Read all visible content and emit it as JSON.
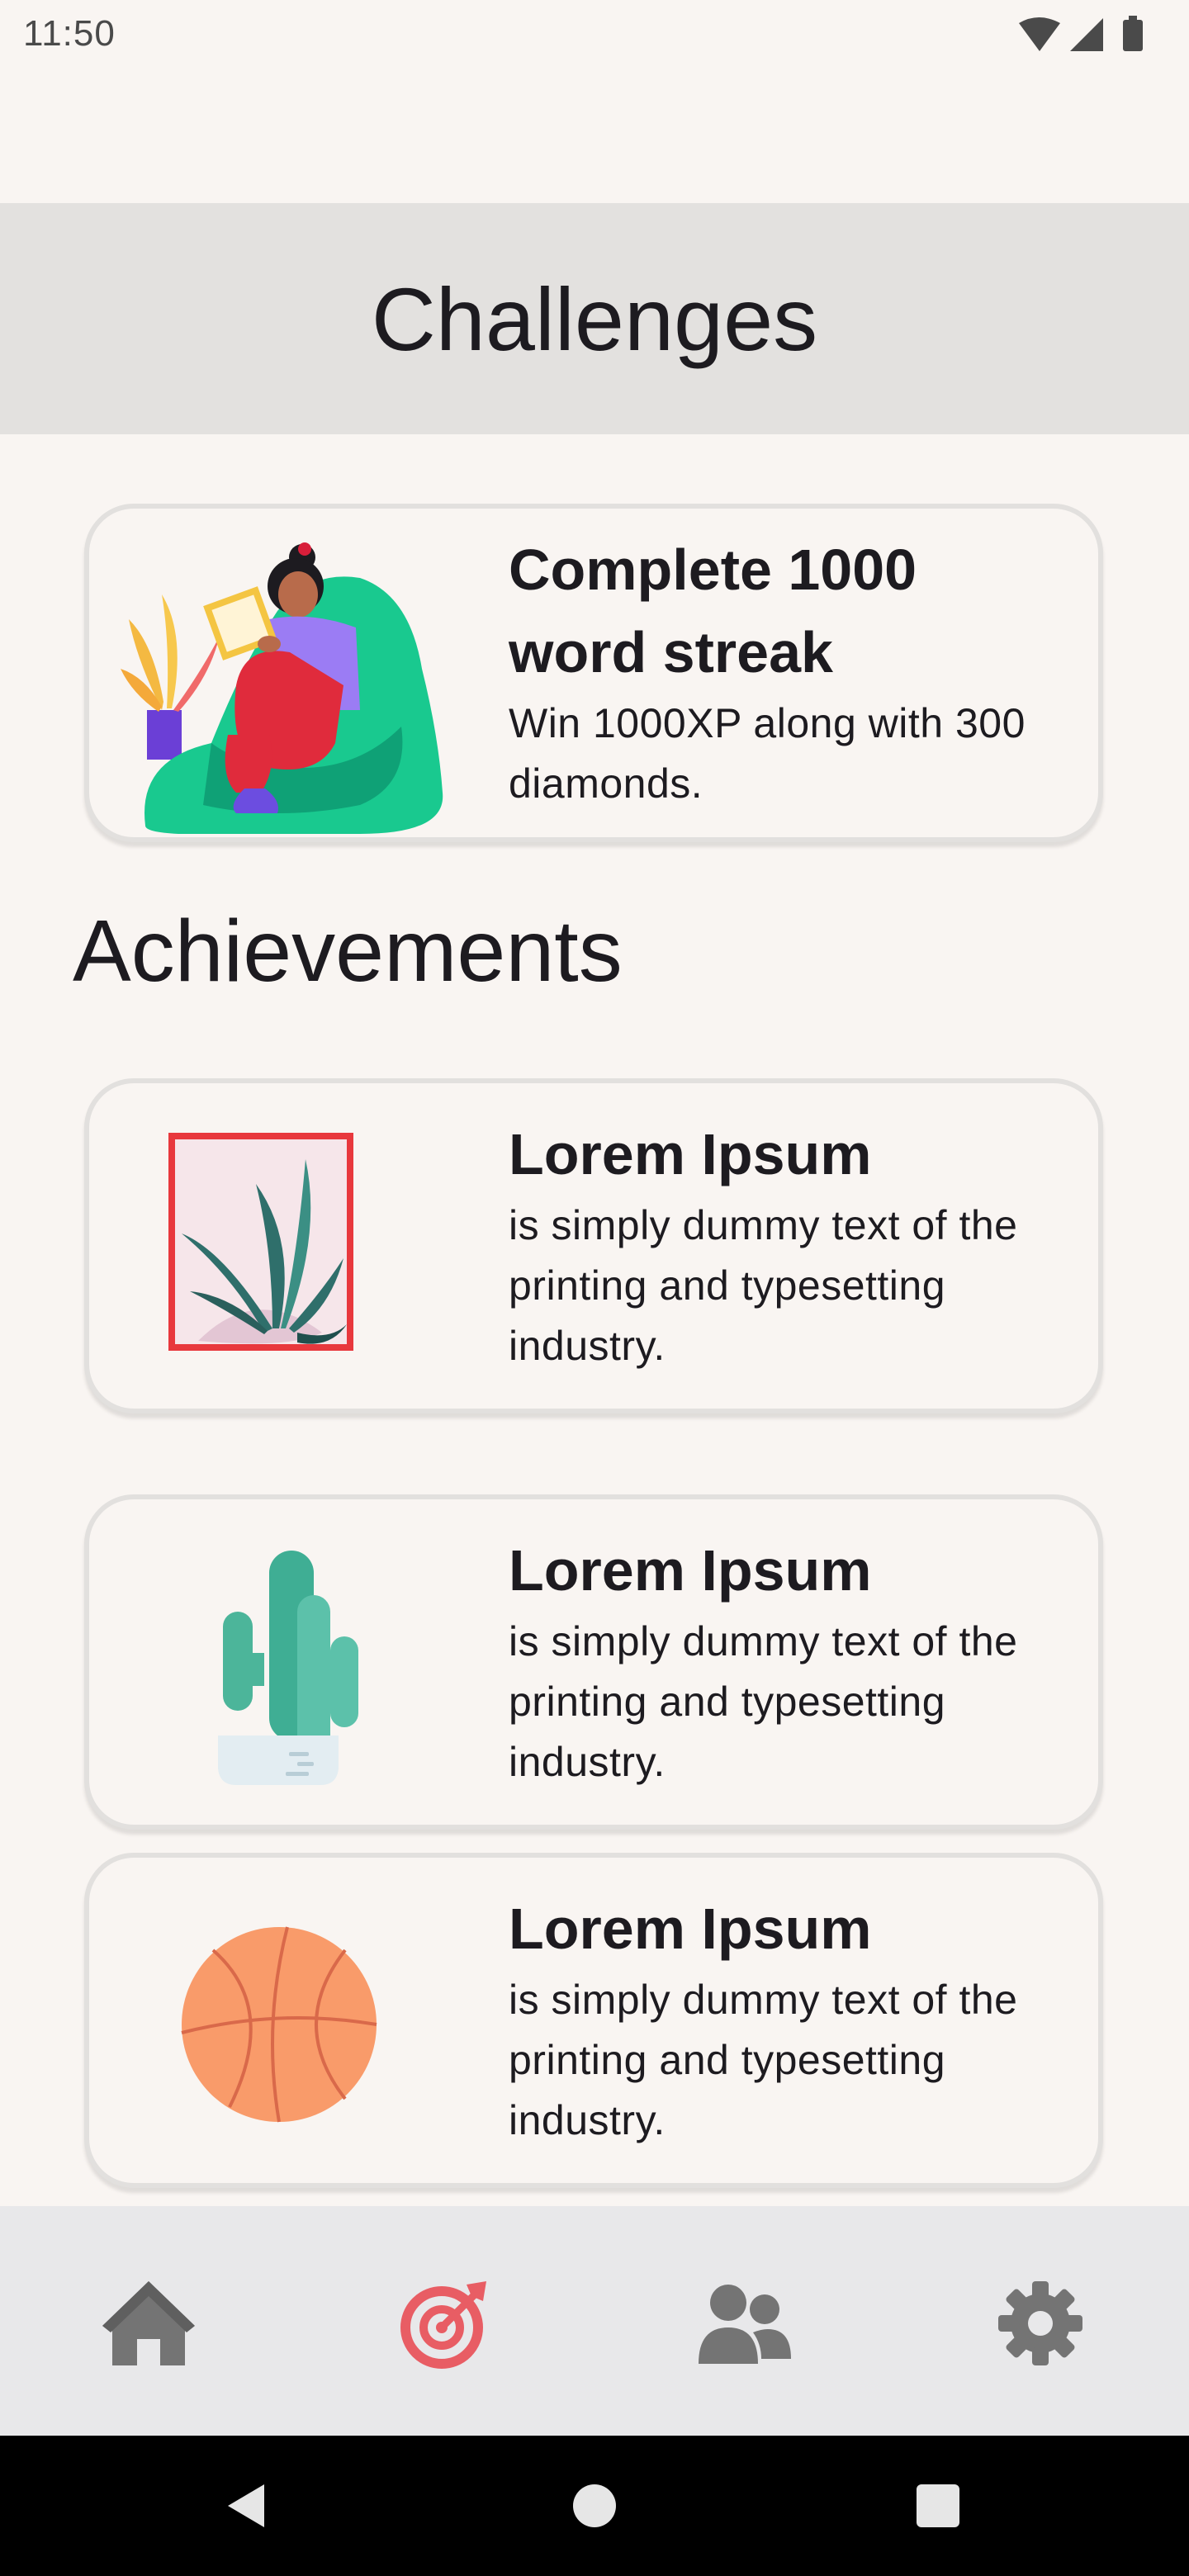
{
  "status_bar": {
    "time": "11:50",
    "icons": [
      "wifi-icon",
      "cellular-signal-icon",
      "battery-icon"
    ]
  },
  "app_bar": {
    "title": "Challenges"
  },
  "challenge": {
    "title": "Complete 1000 word streak",
    "description": "Win 1000XP along with 300 diamonds.",
    "illustration": "girl-reading-beanbag-illustration"
  },
  "achievements": {
    "title": "Achievements",
    "items": [
      {
        "title": "Lorem Ipsum",
        "description": "is simply dummy text of the printing and typesetting industry.",
        "illustration": "framed-plant-illustration"
      },
      {
        "title": "Lorem Ipsum",
        "description": "is simply dummy text of the printing and typesetting industry.",
        "illustration": "cactus-illustration"
      },
      {
        "title": "Lorem Ipsum",
        "description": "is simply dummy text of the printing and typesetting industry.",
        "illustration": "basketball-illustration"
      }
    ]
  },
  "bottom_nav": {
    "items": [
      {
        "name": "home",
        "icon": "home-icon",
        "active": false
      },
      {
        "name": "challenges",
        "icon": "target-icon",
        "active": true
      },
      {
        "name": "friends",
        "icon": "users-icon",
        "active": false
      },
      {
        "name": "settings",
        "icon": "gear-icon",
        "active": false
      }
    ],
    "active_color": "#e85d64",
    "inactive_color": "#747474"
  },
  "system_nav": {
    "buttons": [
      "back-icon",
      "home-circle-icon",
      "recents-icon"
    ]
  },
  "colors": {
    "background": "#f9f5f2",
    "app_bar": "#e3e1df",
    "card_border": "#e2e0de",
    "bottom_nav": "#e8e8ea"
  }
}
